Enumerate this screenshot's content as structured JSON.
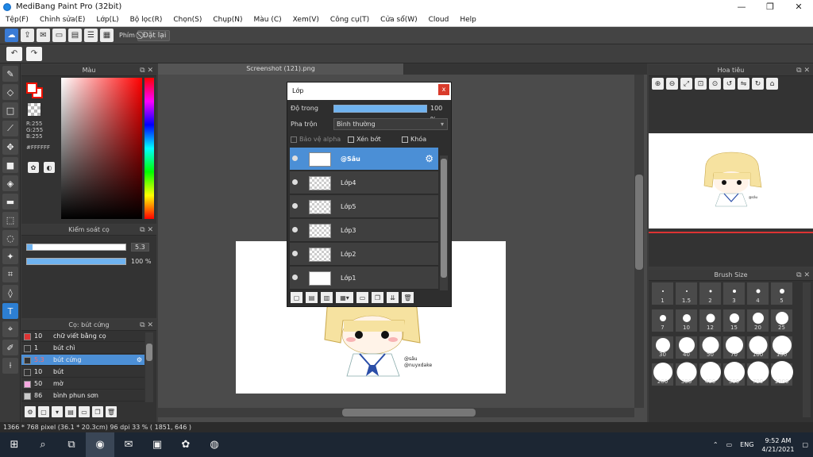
{
  "window": {
    "title": "MediBang Paint Pro (32bit)",
    "controls": [
      "—",
      "❐",
      "✕"
    ]
  },
  "menu": [
    "Tệp(F)",
    "Chỉnh sửa(E)",
    "Lớp(L)",
    "Bộ lọc(R)",
    "Chọn(S)",
    "Chụp(N)",
    "Màu (C)",
    "Xem(V)",
    "Công cụ(T)",
    "Cửa sổ(W)",
    "Cloud",
    "Help"
  ],
  "toolbar": {
    "shortcut_label": "Phím",
    "reset_label": "Đặt lại"
  },
  "color_panel": {
    "title": "Màu",
    "r": "R:255",
    "g": "G:255",
    "b": "B:255",
    "hex": "#FFFFFF"
  },
  "brush_control": {
    "title": "Kiểm soát cọ",
    "size_value": "5.3",
    "size_fraction": 0.06,
    "opacity_value": "100 %",
    "opacity_fraction": 1.0
  },
  "brush_list": {
    "title": "Cọ: bút cứng",
    "items": [
      {
        "size": "10",
        "name": "chữ viết bằng cọ",
        "color": "#d33"
      },
      {
        "size": "1",
        "name": "bút chì",
        "color": "#333"
      },
      {
        "size": "5.3",
        "name": "bút cứng",
        "color": "#333",
        "selected": true
      },
      {
        "size": "10",
        "name": "bút",
        "color": "#333"
      },
      {
        "size": "50",
        "name": "mờ",
        "color": "#f5a8e0"
      },
      {
        "size": "86",
        "name": "bình phun sơn",
        "color": "#ccc"
      }
    ]
  },
  "canvas": {
    "tab_title": "Screenshot (121).png"
  },
  "layer_dialog": {
    "title": "Lớp",
    "close": "x",
    "opacity_label": "Độ trong",
    "opacity_value": "100 %",
    "blend_label": "Pha trộn",
    "blend_value": "Bình thường",
    "protect_alpha": "Bảo vệ alpha",
    "clipping": "Xén bớt",
    "lock": "Khóa",
    "layers": [
      "@Sâu",
      "Lớp4",
      "Lớp5",
      "Lớp3",
      "Lớp2",
      "Lớp1"
    ],
    "active_layer": "@Sâu"
  },
  "navigator": {
    "title": "Hoa tiêu"
  },
  "brush_size": {
    "title": "Brush Size",
    "sizes": [
      "1",
      "1.5",
      "2",
      "3",
      "4",
      "5",
      "7",
      "10",
      "12",
      "15",
      "20",
      "25",
      "30",
      "40",
      "50",
      "70",
      "100",
      "150",
      "200",
      "300",
      "400",
      "500",
      "700",
      "1000"
    ]
  },
  "status": {
    "text": "1366 * 768 pixel  (36.1 * 20.3cm)  96 dpi  33 %  ( 1851, 646 )"
  },
  "taskbar": {
    "lang": "ENG",
    "time": "9:52 AM",
    "date": "4/21/2021"
  },
  "colors": {
    "accent": "#4b8fd6",
    "foreground_swatch_border": "#e10000",
    "close_red": "#d93b2b"
  }
}
